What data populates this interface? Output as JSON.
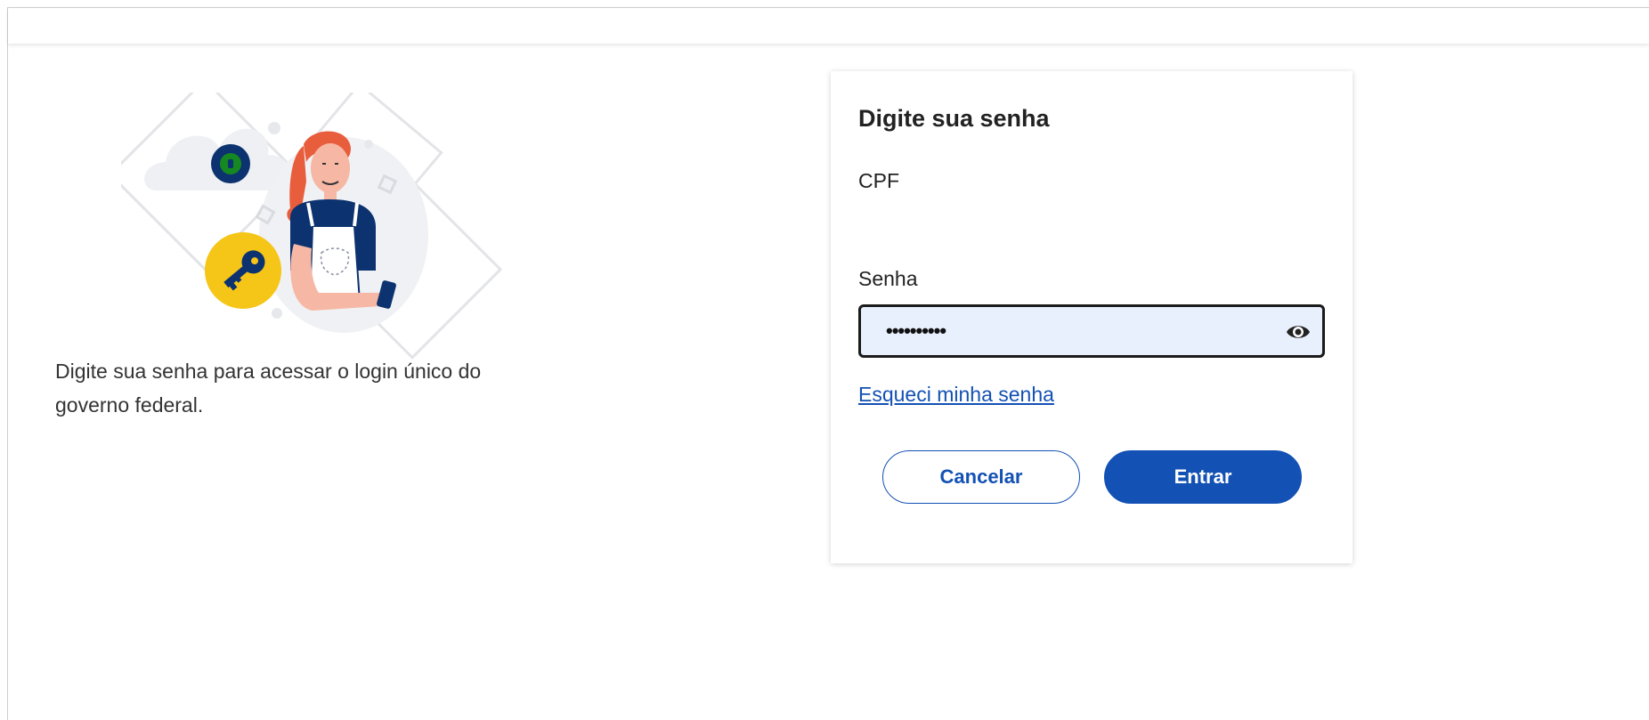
{
  "intro": {
    "text": "Digite sua senha para acessar o login único do governo federal."
  },
  "card": {
    "title": "Digite sua senha",
    "cpf_label": "CPF",
    "password_label": "Senha",
    "password_value": "••••••••••",
    "show_password_icon": "eye-icon",
    "forgot_link": "Esqueci minha senha",
    "cancel_label": "Cancelar",
    "enter_label": "Entrar"
  },
  "colors": {
    "primary": "#1351b4",
    "field_bg": "#e8f0fe",
    "accent_yellow": "#f5c518",
    "navy": "#0c326f"
  }
}
